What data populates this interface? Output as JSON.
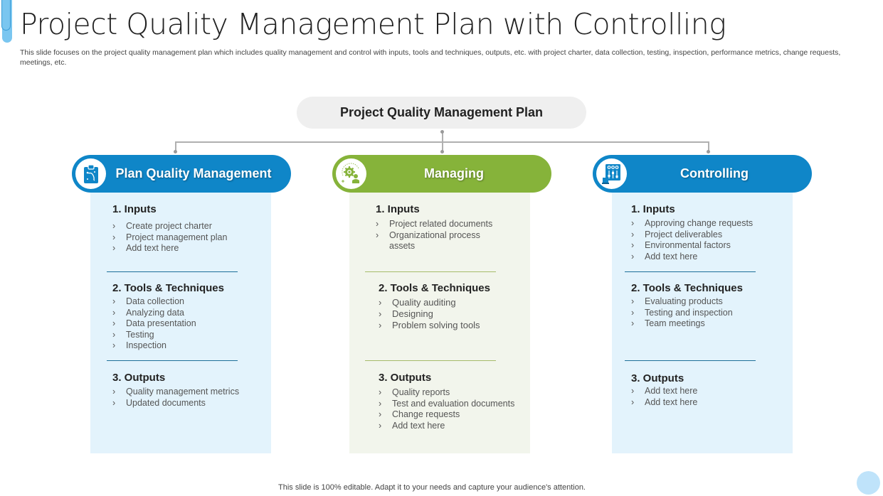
{
  "slide": {
    "title": "Project Quality Management Plan with Controlling",
    "subtitle": "This slide focuses on the project quality management plan which includes quality management and control with inputs, tools and techniques, outputs, etc. with project charter, data collection, testing, inspection, performance metrics, change requests, meetings, etc.",
    "footer": "This slide is 100% editable. Adapt it to your needs and capture your audience's attention."
  },
  "root": {
    "label": "Project Quality  Management Plan"
  },
  "colors": {
    "blue": "#0f86c8",
    "green": "#86b33a",
    "blue_panel": "#e3f3fc",
    "green_panel": "#f2f5ec"
  },
  "columns": [
    {
      "title": "Plan Quality Management",
      "icon": "clipboard-icon",
      "sections": [
        {
          "heading": "1. Inputs",
          "items": [
            "Create project charter",
            "Project management  plan",
            "Add text here"
          ]
        },
        {
          "heading": "2. Tools & Techniques",
          "items": [
            "Data collection",
            "Analyzing data",
            "Data presentation",
            "Testing",
            "Inspection"
          ]
        },
        {
          "heading": "3. Outputs",
          "items": [
            "Quality management  metrics",
            "Updated  documents"
          ]
        }
      ]
    },
    {
      "title": "Managing",
      "icon": "gear-person-icon",
      "sections": [
        {
          "heading": "1. Inputs",
          "items": [
            "Project related documents",
            "Organizational  process assets"
          ]
        },
        {
          "heading": "2. Tools & Techniques",
          "items": [
            "Quality auditing",
            "Designing",
            "Problem solving tools"
          ]
        },
        {
          "heading": "3. Outputs",
          "items": [
            "Quality reports",
            "Test and evaluation  documents",
            "Change  requests",
            "Add text here"
          ]
        }
      ]
    },
    {
      "title": "Controlling",
      "icon": "control-panel-icon",
      "sections": [
        {
          "heading": "1. Inputs",
          "items": [
            "Approving  change requests",
            "Project deliverables",
            "Environmental  factors",
            "Add text here"
          ]
        },
        {
          "heading": "2. Tools & Techniques",
          "items": [
            "Evaluating  products",
            "Testing and inspection",
            "Team  meetings"
          ]
        },
        {
          "heading": "3. Outputs",
          "items": [
            "Add text here",
            "Add text here"
          ]
        }
      ]
    }
  ]
}
